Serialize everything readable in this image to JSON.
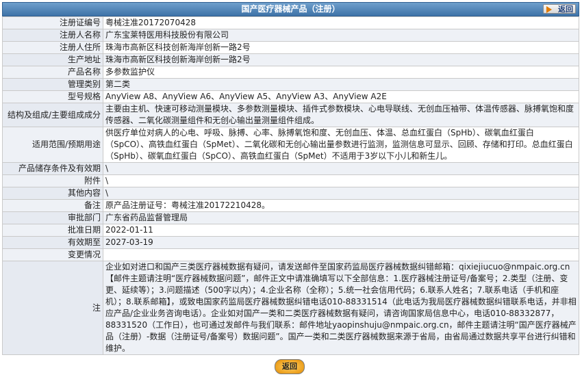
{
  "header": {
    "title": "国产医疗器械产品（注册）",
    "back_label": "返回"
  },
  "rows": [
    {
      "label": "注册证编号",
      "value": "粤械注准20172070428"
    },
    {
      "label": "注册人名称",
      "value": "广东宝莱特医用科技股份有限公司"
    },
    {
      "label": "注册人住所",
      "value": "珠海市高新区科技创新海岸创新一路2号"
    },
    {
      "label": "生产地址",
      "value": "珠海市高新区科技创新海岸创新一路2号"
    },
    {
      "label": "产品名称",
      "value": "多参数监护仪"
    },
    {
      "label": "管理类别",
      "value": "第二类"
    },
    {
      "label": "型号规格",
      "value": "AnyView A8、AnyView A6、AnyView A5、AnyView A3、AnyView A2E"
    },
    {
      "label": "结构及组成/主要组成成分",
      "value": "主要由主机、快速可移动测量模块、多参数测量模块、插件式参数模块、心电导联线、无创血压袖带、体温传感器、脉搏氧饱和度传感器、二氧化碳测量组件和无创心输出量测量组件组成。"
    },
    {
      "label": "适用范围/预期用途",
      "value": "供医疗单位对病人的心电、呼吸、脉搏、心率、脉搏氧饱和度、无创血压、体温、总血红蛋白（SpHb）、碳氧血红蛋白（SpCO）、高铁血红蛋白（SpMet）、二氧化碳和无创心输出量参数进行监测，监测信息可显示、回顾、存储和打印。总血红蛋白（SpHb）、碳氧血红蛋白（SpCO）、高铁血红蛋白（SpMet）不适用于3岁以下小儿和新生儿。"
    },
    {
      "label": "产品储存条件及有效期",
      "value": "\\"
    },
    {
      "label": "附件",
      "value": "\\"
    },
    {
      "label": "其他内容",
      "value": "\\"
    },
    {
      "label": "备注",
      "value": "原产品注册证号：粤械注准20172210428。"
    },
    {
      "label": "审批部门",
      "value": "广东省药品监督管理局"
    },
    {
      "label": "批准日期",
      "value": "2022-01-11"
    },
    {
      "label": "有效期至",
      "value": "2027-03-19"
    },
    {
      "label": "变更情况",
      "value": ""
    }
  ],
  "note": {
    "label": "注",
    "text": "企业如对进口和国产三类医疗器械数据有疑问，请发送邮件至国家药监局医疗器械数据纠错邮箱：qixiejiucuo@nmpaic.org.cn【邮件主题请注明“医疗器械数据问题”，邮件正文中请准确填写以下全部信息：1.医疗器械注册证号/备案号；2.类型（注册、变更、延续等）；3.问题描述（500字以内）；4.企业名称（全称）；5.统一社会信用代码；6.联系人姓名；7.联系电话（手机和座机）；8.联系邮箱】，或致电国家药监局医疗器械数据纠错电话010-88331514（此电话为我局医疗器械数据纠错联系电话，并非相应产品/企业业务咨询电话）。企业如对国产一类和二类医疗器械数据有疑问，请咨询国家局信息中心，电话010-88332877，88331520（工作日），也可通过发邮件与我们联系：邮件地址yaopinshuju@nmpaic.org.cn，邮件主题请注明“国产医疗器械产品（注册）-数据（注册证号/备案号）数据问题”。国产一类和二类医疗器械数据来源于省局，由省局通过数据共享平台进行纠错和维护。"
  },
  "footer": {
    "back_label": "返回"
  }
}
